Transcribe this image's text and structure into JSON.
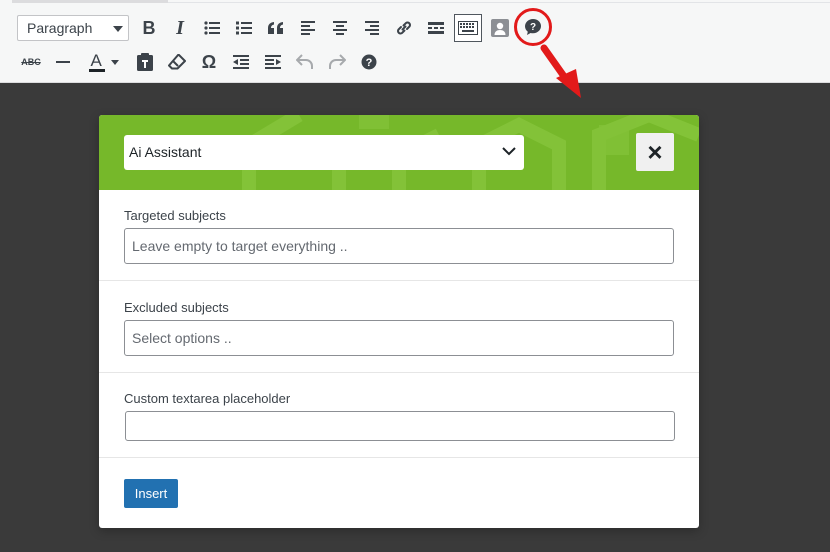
{
  "toolbar": {
    "format_select": "Paragraph",
    "row1_icons": [
      "bold-icon",
      "italic-icon",
      "bullet-list-icon",
      "numbered-list-icon",
      "blockquote-icon",
      "align-left-icon",
      "align-center-icon",
      "align-right-icon",
      "link-icon",
      "read-more-icon",
      "toolbar-toggle-icon",
      "contact-card-icon",
      "ai-chat-icon"
    ],
    "row2_icons": [
      "strikethrough-icon",
      "horizontal-line-icon",
      "text-color-icon",
      "paste-text-icon",
      "clear-formatting-icon",
      "special-character-icon",
      "outdent-icon",
      "indent-icon",
      "undo-icon",
      "redo-icon",
      "help-icon"
    ],
    "bold_glyph": "B",
    "italic_glyph": "I",
    "strike_glyph": "ABC",
    "text_color_glyph": "A",
    "omega_glyph": "Ω"
  },
  "annotation": {
    "color": "#e21a1a"
  },
  "modal": {
    "header_color": "#76b82a",
    "model_select_value": "Ai Assistant",
    "close_label": "×",
    "fields": {
      "targeted": {
        "label": "Targeted subjects",
        "placeholder": "Leave empty to target everything .."
      },
      "excluded": {
        "label": "Excluded subjects",
        "placeholder": "Select options .."
      },
      "custom": {
        "label": "Custom textarea placeholder",
        "value": ""
      }
    },
    "insert_label": "Insert"
  }
}
